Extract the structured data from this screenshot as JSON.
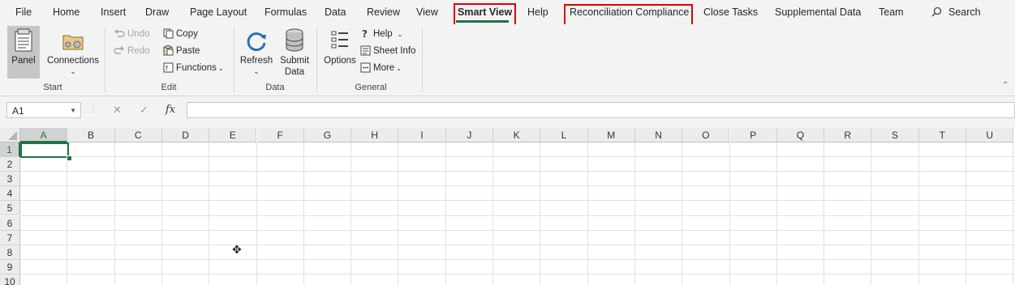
{
  "tabs": [
    "File",
    "Home",
    "Insert",
    "Draw",
    "Page Layout",
    "Formulas",
    "Data",
    "Review",
    "View",
    "Smart View",
    "Help",
    "Reconciliation Compliance",
    "Close Tasks",
    "Supplemental Data",
    "Team"
  ],
  "search_label": "Search",
  "ribbon": {
    "start": {
      "panel": "Panel",
      "connections": "Connections",
      "label": "Start"
    },
    "edit": {
      "undo": "Undo",
      "redo": "Redo",
      "copy": "Copy",
      "paste": "Paste",
      "functions": "Functions",
      "label": "Edit"
    },
    "data": {
      "refresh": "Refresh",
      "submit_line1": "Submit",
      "submit_line2": "Data",
      "label": "Data"
    },
    "general": {
      "options": "Options",
      "help": "Help",
      "sheet_info": "Sheet Info",
      "more": "More",
      "label": "General"
    }
  },
  "formula_bar": {
    "name_box": "A1",
    "fx": "fx",
    "value": ""
  },
  "columns": [
    "A",
    "B",
    "C",
    "D",
    "E",
    "F",
    "G",
    "H",
    "I",
    "J",
    "K",
    "L",
    "M",
    "N",
    "O",
    "P",
    "Q",
    "R",
    "S",
    "T",
    "U"
  ],
  "rows": [
    "1",
    "2",
    "3",
    "4",
    "5",
    "6",
    "7",
    "8",
    "9",
    "10"
  ],
  "colors": {
    "accent": "#217346",
    "highlight": "#e00000"
  }
}
